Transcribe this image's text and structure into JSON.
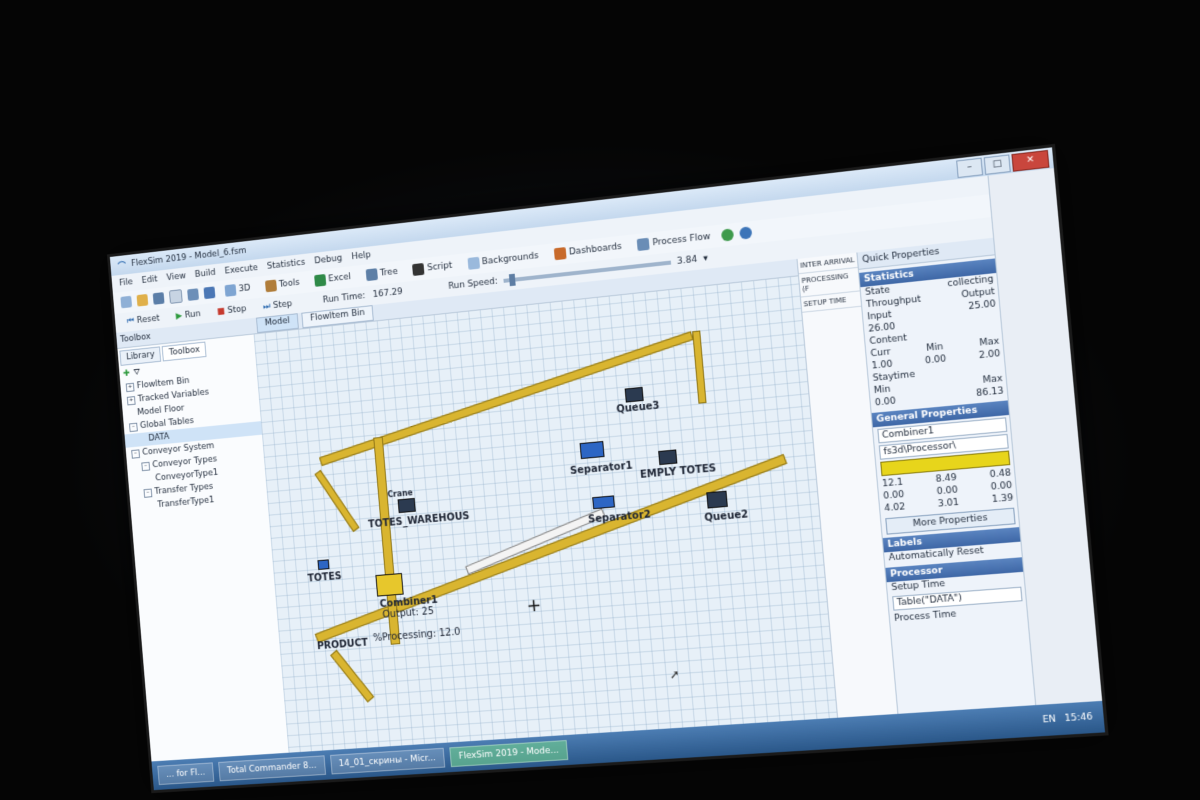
{
  "app": {
    "title": "FlexSim 2019 - Model_6.fsm"
  },
  "menu": [
    "File",
    "Edit",
    "View",
    "Build",
    "Execute",
    "Statistics",
    "Debug",
    "Help"
  ],
  "toolbar": {
    "items": [
      "3D",
      "Tools",
      "Excel",
      "Tree",
      "Script",
      "Backgrounds",
      "Dashboards",
      "Process Flow"
    ]
  },
  "run_controls": {
    "reset": "Reset",
    "run": "Run",
    "stop": "Stop",
    "step": "Step",
    "run_time_label": "Run Time:",
    "run_time_value": "167.29",
    "run_speed_label": "Run Speed:",
    "run_speed_value": "3.84"
  },
  "toolbox": {
    "title": "Toolbox",
    "tabs": [
      "Library",
      "Toolbox"
    ],
    "tree": [
      {
        "label": "FlowItem Bin",
        "depth": 0
      },
      {
        "label": "Tracked Variables",
        "depth": 0
      },
      {
        "label": "Model Floor",
        "depth": 0
      },
      {
        "label": "Global Tables",
        "depth": 0
      },
      {
        "label": "DATA",
        "depth": 1,
        "selected": true
      },
      {
        "label": "Conveyor System",
        "depth": 0
      },
      {
        "label": "Conveyor Types",
        "depth": 1
      },
      {
        "label": "ConveyorType1",
        "depth": 2
      },
      {
        "label": "Transfer Types",
        "depth": 1
      },
      {
        "label": "TransferType1",
        "depth": 2
      }
    ]
  },
  "document_tabs": [
    "Model",
    "FlowItem Bin"
  ],
  "model_objects": {
    "queue3": "Queue3",
    "separator1": "Separator1",
    "emply_totes": "EMPLY TOTES",
    "totes_warehous": "TOTES_WAREHOUS",
    "crane": "Crane",
    "separator2": "Separator2",
    "queue2": "Queue2",
    "totes": "TOTES",
    "combiner1": "Combiner1",
    "combiner_output": "Output: 25",
    "product": "PRODUCT",
    "processing": "%Processing: 12.0"
  },
  "side_list": [
    "INTER ARRIVAL",
    "PROCESSING (F",
    "SETUP TIME"
  ],
  "quick_properties": {
    "title": "Quick Properties",
    "statistics": {
      "header": "Statistics",
      "state_label": "State",
      "state_value": "collecting",
      "throughput_label": "Throughput",
      "input_label": "Input",
      "output_label": "Output",
      "input_value": "26.00",
      "output_value": "25.00",
      "content_label": "Content",
      "curr_label": "Curr",
      "min_label": "Min",
      "max_label": "Max",
      "content_curr": "1.00",
      "content_min": "0.00",
      "content_max": "2.00",
      "staytime_label": "Staytime",
      "staytime_min": "0.00",
      "staytime_max": "86.13"
    },
    "general": {
      "header": "General Properties",
      "name": "Combiner1",
      "shape": "fs3d\\Processor\\",
      "position": [
        "12.1",
        "8.49",
        "0.48"
      ],
      "rotation": [
        "0.00",
        "0.00",
        "0.00"
      ],
      "size": [
        "4.02",
        "3.01",
        "1.39"
      ],
      "more_button": "More Properties"
    },
    "labels": {
      "header": "Labels",
      "auto_reset": "Automatically Reset"
    },
    "processor": {
      "header": "Processor",
      "setup_time_label": "Setup Time",
      "setup_time_value": "Table(\"DATA\")",
      "process_time_label": "Process Time"
    }
  },
  "taskbar": {
    "tasks": [
      "... for Fl...",
      "Total Commander 8...",
      "14_01_скрины - Micr...",
      "FlexSim 2019 - Mode..."
    ],
    "lang": "EN",
    "clock": "15:46"
  }
}
